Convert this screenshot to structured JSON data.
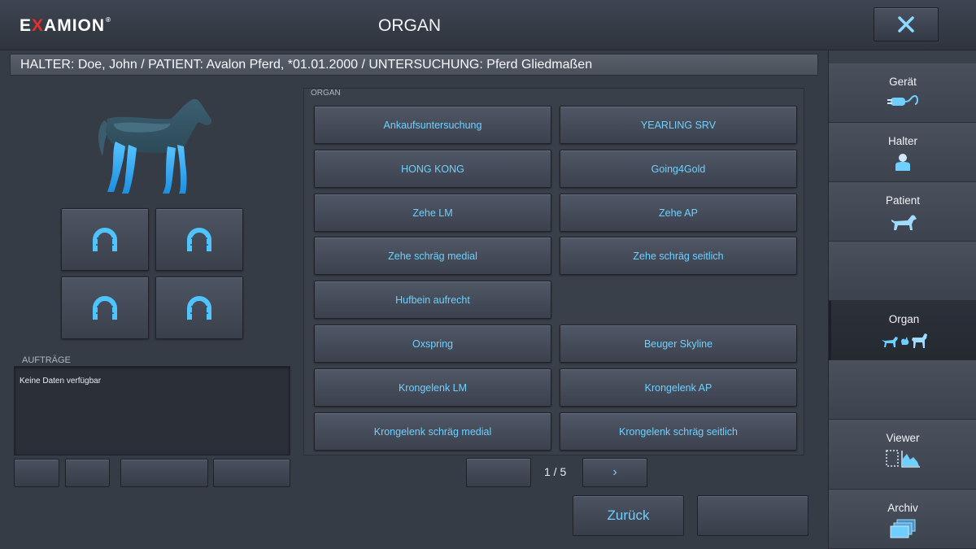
{
  "header": {
    "logo_pre": "E",
    "logo_x": "X",
    "logo_post": "AMION",
    "logo_mark": "®",
    "title": "ORGAN",
    "close_icon": "close-icon"
  },
  "info_bar": {
    "text": "HALTER: Doe, John / PATIENT: Avalon Pferd, *01.01.2000 / UNTERSUCHUNG: Pferd Gliedmaßen"
  },
  "hooves": {
    "icon": "horseshoe-icon"
  },
  "orders": {
    "label": "AUFTRÄGE",
    "empty_text": "Keine Daten verfügbar"
  },
  "organ": {
    "label": "ORGAN",
    "buttons": [
      "Ankaufsuntersuchung",
      "YEARLING SRV",
      "HONG KONG",
      "Going4Gold",
      "Zehe LM",
      "Zehe AP",
      "Zehe schräg medial",
      "Zehe schräg seitlich",
      "Hufbein aufrecht",
      "Oxspring",
      "Beuger Skyline",
      "Krongelenk LM",
      "Krongelenk AP",
      "Krongelenk schräg medial",
      "Krongelenk schräg seitlich"
    ]
  },
  "pagination": {
    "indicator": "1 / 5",
    "next_glyph": "›"
  },
  "actions": {
    "back_label": "Zurück"
  },
  "sidebar": {
    "items": [
      {
        "label": "Gerät",
        "icon": "device-plug-icon"
      },
      {
        "label": "Halter",
        "icon": "owner-person-icon"
      },
      {
        "label": "Patient",
        "icon": "dog-icon"
      },
      {
        "label": "Organ",
        "icon": "animals-icon"
      },
      {
        "label": "Viewer",
        "icon": "viewer-histogram-icon"
      },
      {
        "label": "Archiv",
        "icon": "archive-folders-icon"
      }
    ]
  },
  "colors": {
    "accent": "#6fd0ff",
    "background": "#363c46",
    "logo_x": "#e8302a"
  }
}
